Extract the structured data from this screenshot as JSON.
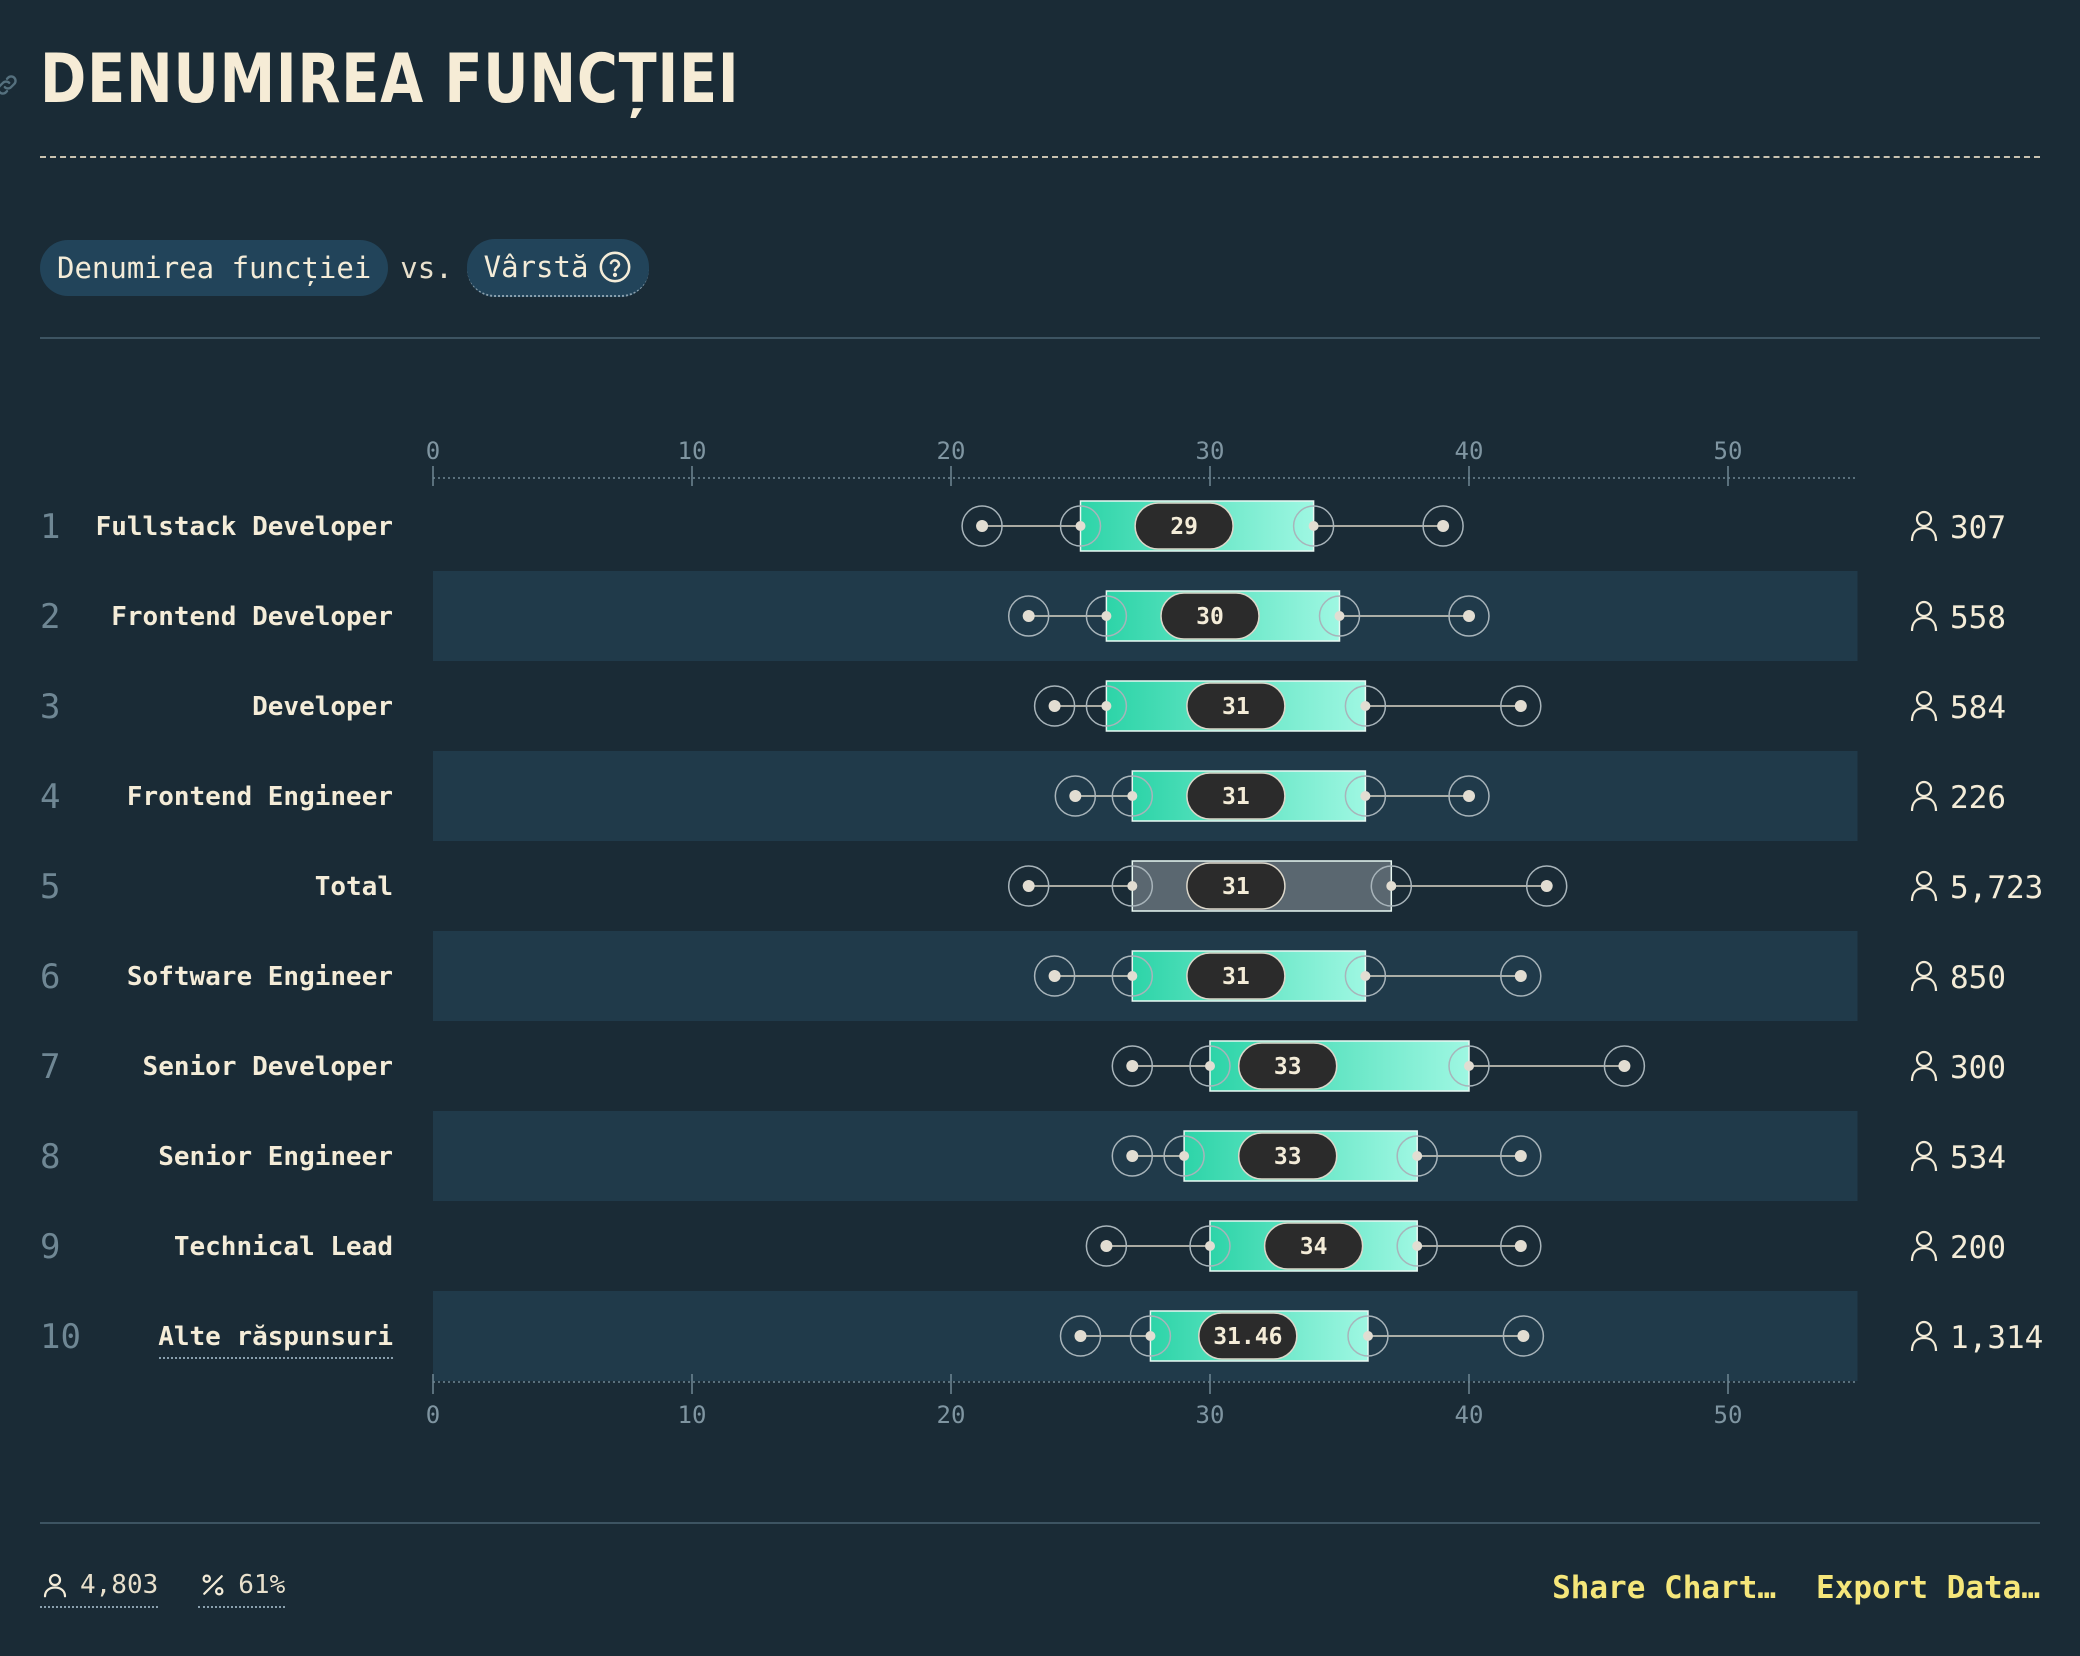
{
  "page": {
    "title": "DENUMIREA FUNCȚIEI",
    "x_variable": "Denumirea funcției",
    "vs_text": "vs.",
    "y_variable": "Vârstă"
  },
  "footer": {
    "respondents": "4,803",
    "percent": "61%",
    "share_label": "Share Chart…",
    "export_label": "Export Data…"
  },
  "colors": {
    "background": "#1a2b36",
    "band": "#203a4a",
    "box_start": "#2dd4a8",
    "box_end": "#9ef7e2",
    "total_box": "#5a6770",
    "accent_link": "#f5e67a"
  },
  "icons": [
    "link-icon",
    "help-circle-icon",
    "user-icon",
    "percent-icon"
  ],
  "chart_data": {
    "type": "boxplot",
    "xlim": [
      0,
      55
    ],
    "ticks": [
      0,
      10,
      20,
      30,
      40,
      50
    ],
    "rows": [
      {
        "rank": "1",
        "label": "Fullstack Developer",
        "p10": 21.2,
        "q1": 25,
        "median": 29,
        "q3": 34,
        "p90": 39,
        "median_label": "29",
        "count": "307",
        "highlight": false
      },
      {
        "rank": "2",
        "label": "Frontend Developer",
        "p10": 23,
        "q1": 26,
        "median": 30,
        "q3": 35,
        "p90": 40,
        "median_label": "30",
        "count": "558",
        "highlight": false
      },
      {
        "rank": "3",
        "label": "Developer",
        "p10": 24,
        "q1": 26,
        "median": 31,
        "q3": 36,
        "p90": 42,
        "median_label": "31",
        "count": "584",
        "highlight": false
      },
      {
        "rank": "4",
        "label": "Frontend Engineer",
        "p10": 24.8,
        "q1": 27,
        "median": 31,
        "q3": 36,
        "p90": 40,
        "median_label": "31",
        "count": "226",
        "highlight": false
      },
      {
        "rank": "5",
        "label": "Total",
        "p10": 23,
        "q1": 27,
        "median": 31,
        "q3": 37,
        "p90": 43,
        "median_label": "31",
        "count": "5,723",
        "highlight": true
      },
      {
        "rank": "6",
        "label": "Software Engineer",
        "p10": 24,
        "q1": 27,
        "median": 31,
        "q3": 36,
        "p90": 42,
        "median_label": "31",
        "count": "850",
        "highlight": false
      },
      {
        "rank": "7",
        "label": "Senior Developer",
        "p10": 27,
        "q1": 30,
        "median": 33,
        "q3": 40,
        "p90": 46,
        "median_label": "33",
        "count": "300",
        "highlight": false
      },
      {
        "rank": "8",
        "label": "Senior Engineer",
        "p10": 27,
        "q1": 29,
        "median": 33,
        "q3": 38,
        "p90": 42,
        "median_label": "33",
        "count": "534",
        "highlight": false
      },
      {
        "rank": "9",
        "label": "Technical Lead",
        "p10": 26,
        "q1": 30,
        "median": 34,
        "q3": 38,
        "p90": 42,
        "median_label": "34",
        "count": "200",
        "highlight": false
      },
      {
        "rank": "10",
        "label": "Alte răspunsuri",
        "p10": 25,
        "q1": 27.7,
        "median": 31.46,
        "q3": 36.1,
        "p90": 42.1,
        "median_label": "31.46",
        "count": "1,314",
        "highlight": false
      }
    ]
  }
}
